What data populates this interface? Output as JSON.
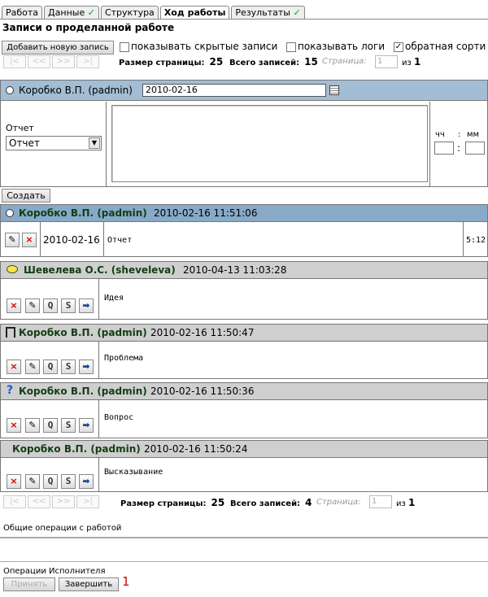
{
  "tabs": [
    {
      "label": "Работа",
      "check": false,
      "active": false
    },
    {
      "label": "Данные",
      "check": true,
      "active": false
    },
    {
      "label": "Структура",
      "check": false,
      "active": false
    },
    {
      "label": "Ход работы",
      "check": false,
      "active": true
    },
    {
      "label": "Результаты",
      "check": true,
      "active": false
    }
  ],
  "page_title": "Записи о проделанной работе",
  "add_button": "Добавить новую запись",
  "options": {
    "show_hidden": {
      "label": "показывать скрытые записи",
      "checked": false
    },
    "show_logs": {
      "label": "показывать логи",
      "checked": false
    },
    "reverse_sort": {
      "label": "обратная сорти",
      "checked": true
    }
  },
  "pager_top": {
    "size_label": "Размер страницы:",
    "size": "25",
    "total_label": "Всего записей:",
    "total": "15",
    "page_label": "Страница:",
    "page_input": "1",
    "of": "из",
    "pages": "1"
  },
  "pager_bottom": {
    "size_label": "Размер страницы:",
    "size": "25",
    "total_label": "Всего записей:",
    "total": "4",
    "page_label": "Страница:",
    "page_input": "1",
    "of": "из",
    "pages": "1"
  },
  "pager_buttons": [
    "|<",
    "<<",
    ">>",
    ">|"
  ],
  "form": {
    "user": "Коробко В.П. (padmin)",
    "date": "2010-02-16",
    "report_label": "Отчет",
    "report_select": "Отчет",
    "hh_label": "чч",
    "mm_label": "мм",
    "colon": ":",
    "create_button": "Создать"
  },
  "entries": [
    {
      "user": "Коробко В.П. (padmin)",
      "timestamp": "2010-02-16 11:51:06",
      "date": "2010-02-16",
      "text": "Отчет",
      "duration": "5:12"
    },
    {
      "user": "Шевелева О.С. (sheveleva)",
      "timestamp": "2010-04-13 11:03:28",
      "text": "Идея"
    },
    {
      "user": "Коробко В.П. (padmin)",
      "timestamp": "2010-02-16 11:50:47",
      "text": "Проблема"
    },
    {
      "user": "Коробко В.П. (padmin)",
      "timestamp": "2010-02-16 11:50:36",
      "text": "Вопрос",
      "icon_char": "?"
    },
    {
      "user": "Коробко В.П. (padmin)",
      "timestamp": "2010-02-16 11:50:24",
      "text": "Высказывание"
    }
  ],
  "icon_labels": {
    "cancel": "×",
    "q": "Q",
    "s": "S",
    "move": "➡"
  },
  "general_ops_label": "Общие операции с работой",
  "executor_ops_label": "Операции Исполнителя",
  "accept_button": "Принять",
  "finish_button": "Завершить",
  "annotation": "1"
}
